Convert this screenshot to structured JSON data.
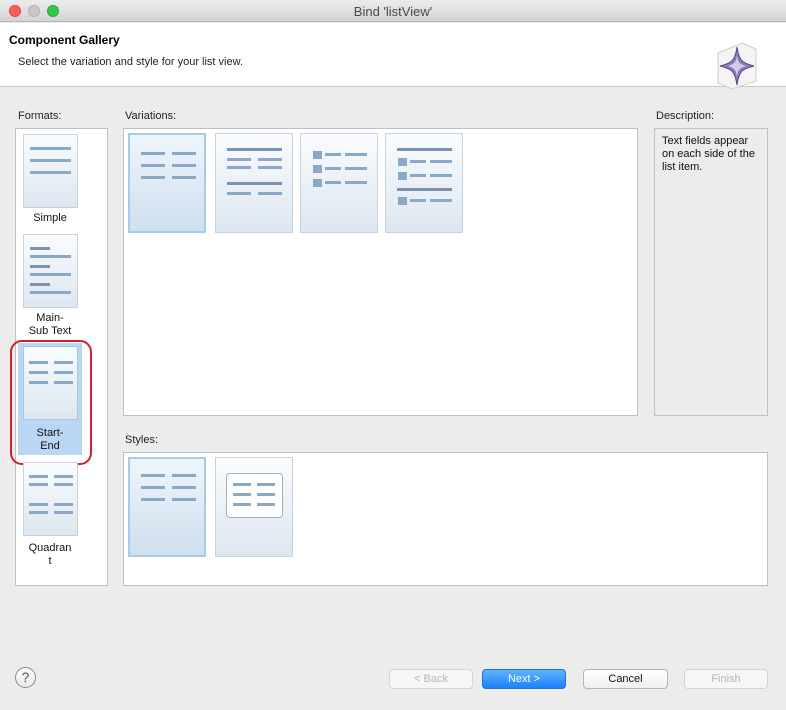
{
  "window": {
    "title": "Bind 'listView'"
  },
  "header": {
    "title": "Component Gallery",
    "subtitle": "Select the variation and style for your list view."
  },
  "formats": {
    "label": "Formats:",
    "items": [
      {
        "label_lines": [
          "Simple"
        ]
      },
      {
        "label_lines": [
          "Main-",
          "Sub Text"
        ]
      },
      {
        "label_lines": [
          "Start-",
          "End"
        ]
      },
      {
        "label_lines": [
          "Quadran",
          "t"
        ]
      }
    ],
    "selected_index": 2
  },
  "variations": {
    "label": "Variations:",
    "count": 4,
    "selected_index": 0
  },
  "styles": {
    "label": "Styles:",
    "count": 2,
    "selected_index": 0
  },
  "description": {
    "label": "Description:",
    "text": "Text fields appear on each side of the list item."
  },
  "buttons": {
    "help": "?",
    "back": "< Back",
    "next": "Next >",
    "cancel": "Cancel",
    "finish": "Finish"
  },
  "colors": {
    "primary_button": "#1a82fb",
    "selection": "#b9d6f3",
    "highlight_ring": "#d0202a"
  }
}
